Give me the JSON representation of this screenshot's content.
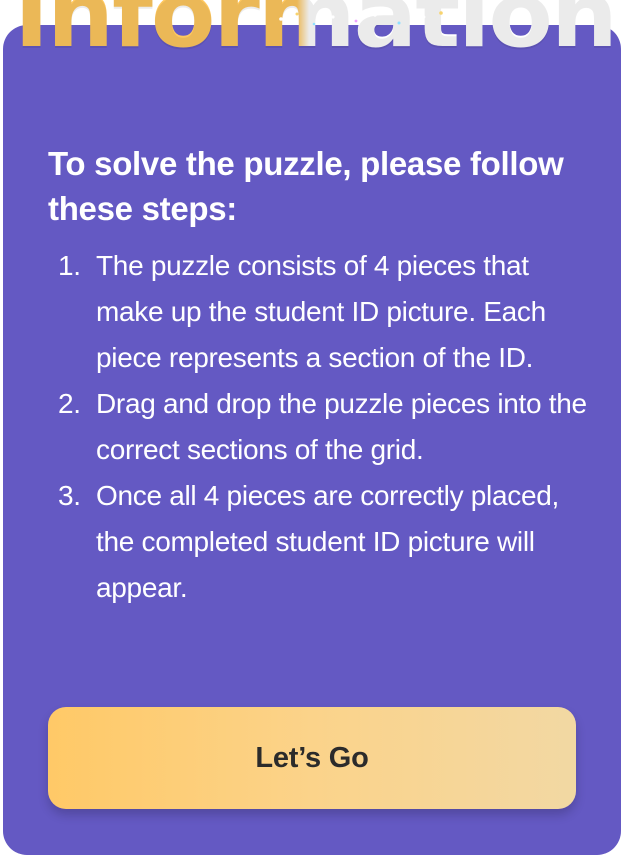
{
  "dialog": {
    "title": "Information",
    "lead": "To solve the puzzle, please follow these steps:",
    "steps": [
      {
        "number": "1.",
        "text": "The puzzle consists of 4 pieces that make up the student ID picture. Each piece represents a section of the ID."
      },
      {
        "number": "2.",
        "text": "Drag and drop the puzzle pieces into the correct sections of the grid."
      },
      {
        "number": "3.",
        "text": "Once all 4 pieces are correctly placed, the completed student ID picture will appear."
      }
    ],
    "button_label": "Let’s Go"
  },
  "colors": {
    "card_background": "#6459c3",
    "title_accent": "#ffc85f",
    "button_gradient_start": "#ffc967",
    "button_gradient_end": "#f2d8a3",
    "text_primary": "#ffffff",
    "button_text": "#2b2b2b"
  },
  "icons": {
    "title_decoration": "sparkles-icon"
  }
}
